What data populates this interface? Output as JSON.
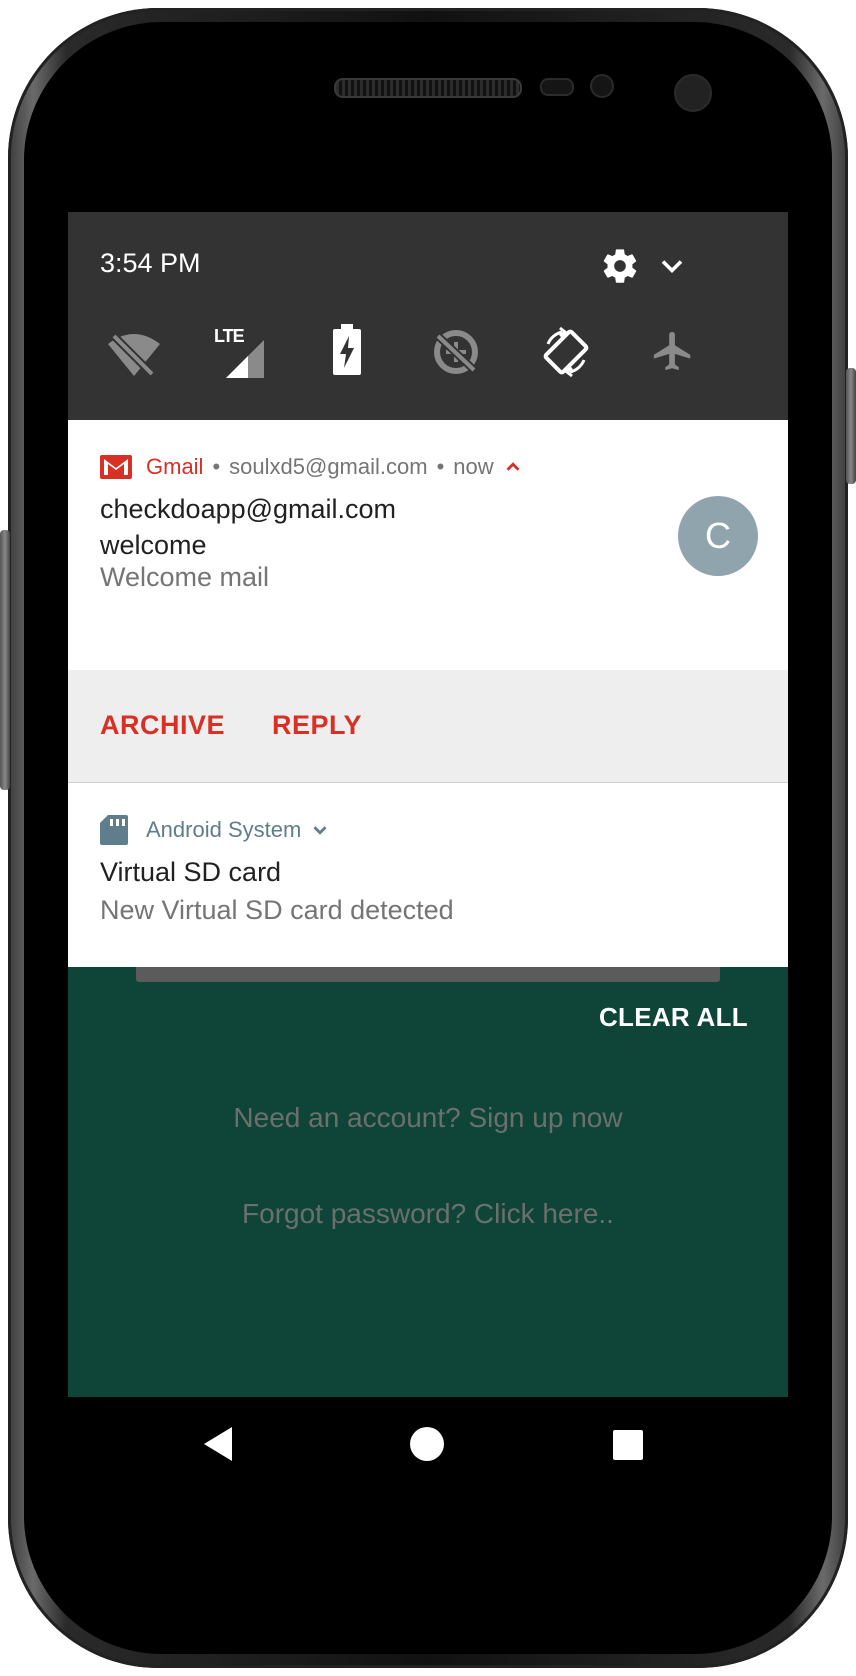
{
  "status": {
    "time": "3:54 PM"
  },
  "quick_settings": {
    "icons": [
      "wifi-off-icon",
      "lte-signal-icon",
      "battery-charging-icon",
      "data-saver-off-icon",
      "auto-rotate-icon",
      "airplane-mode-icon"
    ],
    "lte_label": "LTE"
  },
  "notifications": {
    "gmail": {
      "app": "Gmail",
      "account": "soulxd5@gmail.com",
      "time": "now",
      "sender": "checkdoapp@gmail.com",
      "subject": "welcome",
      "preview": "Welcome mail",
      "avatar_letter": "C",
      "actions": [
        "ARCHIVE",
        "REPLY"
      ]
    },
    "system": {
      "app": "Android System",
      "title": "Virtual SD card",
      "text": "New Virtual SD card detected"
    },
    "clear_all": "CLEAR ALL"
  },
  "background_app": {
    "signup_link": "Need an account? Sign up now",
    "forgot_link": "Forgot password? Click here.."
  },
  "colors": {
    "accent": "#d93025",
    "app_background": "#0f4538",
    "quick_settings_bg": "#333333",
    "system_accent": "#607d8b"
  }
}
